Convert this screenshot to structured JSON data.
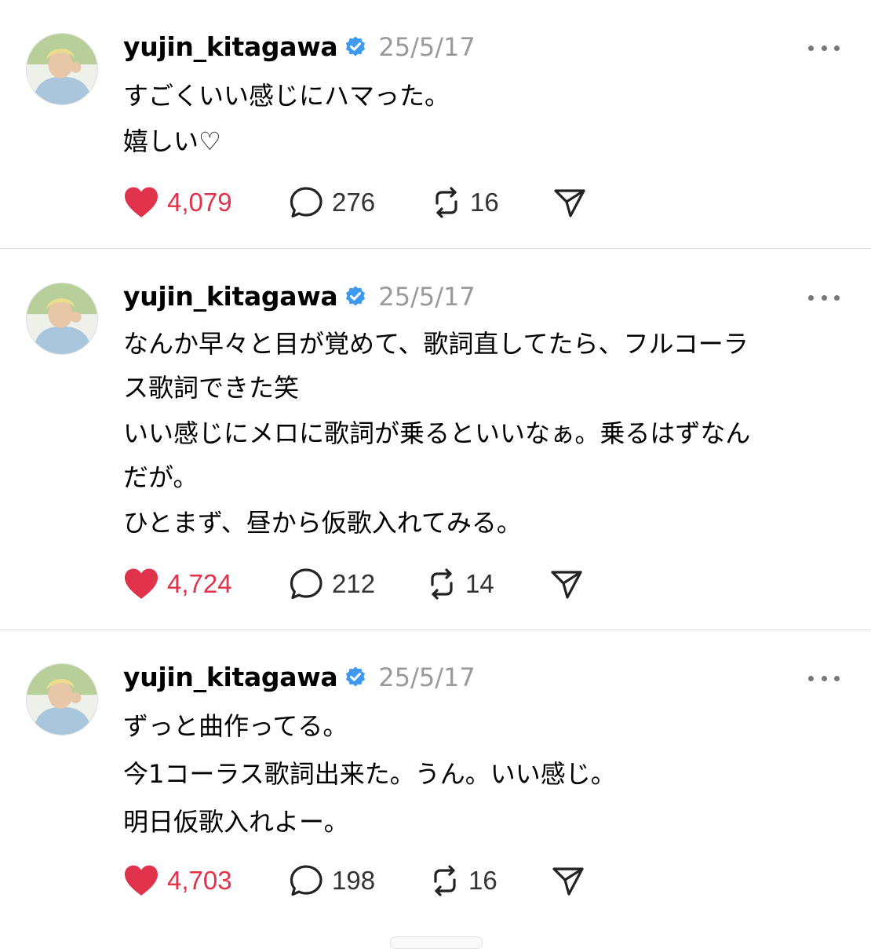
{
  "colors": {
    "like": "#e0334b",
    "verified": "#3d9af0",
    "date": "#9a9a9a"
  },
  "posts": [
    {
      "username": "yujin_kitagawa",
      "date": "25/5/17",
      "lines": [
        "すごくいい感じにハマった。",
        "嬉しい♡"
      ],
      "likes": "4,079",
      "replies": "276",
      "reposts": "16"
    },
    {
      "username": "yujin_kitagawa",
      "date": "25/5/17",
      "lines": [
        "なんか早々と目が覚めて、歌詞直してたら、フルコーラ",
        "ス歌詞できた笑",
        "いい感じにメロに歌詞が乗るといいなぁ。乗るはずなん",
        "だが。",
        "ひとまず、昼から仮歌入れてみる。"
      ],
      "likes": "4,724",
      "replies": "212",
      "reposts": "14"
    },
    {
      "username": "yujin_kitagawa",
      "date": "25/5/17",
      "lines": [
        "ずっと曲作ってる。",
        "今1コーラス歌詞出来た。うん。いい感じ。",
        "明日仮歌入れよー。"
      ],
      "likes": "4,703",
      "replies": "198",
      "reposts": "16"
    }
  ],
  "icons": {
    "like": "heart-icon",
    "reply": "speech-bubble-icon",
    "repost": "repost-arrows-icon",
    "share": "paper-plane-icon",
    "more": "more-dots-icon",
    "verified": "verified-badge-icon"
  }
}
